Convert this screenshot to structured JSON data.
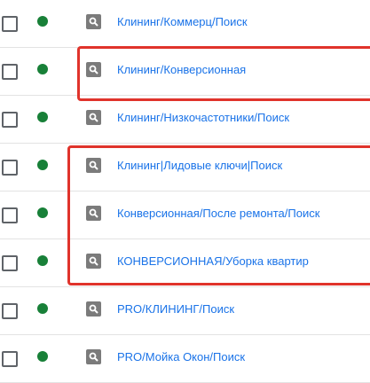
{
  "rows": [
    {
      "name": "Клининг/Коммерц/Поиск"
    },
    {
      "name": "Клининг/Конверсионная"
    },
    {
      "name": "Клининг/Низкочастотники/Поиск"
    },
    {
      "name": "Клининг|Лидовые ключи|Поиск"
    },
    {
      "name": "Конверсионная/После ремонта/Поиск"
    },
    {
      "name": "КОНВЕРСИОННАЯ/Уборка квартир"
    },
    {
      "name": "PRO/КЛИНИНГ/Поиск"
    },
    {
      "name": "PRO/Мойка Окон/Поиск"
    }
  ],
  "colors": {
    "status_dot": "#188038",
    "link": "#1a73e8",
    "highlight": "#e0332b",
    "type_badge": "#7b7b7b"
  },
  "icons": {
    "checkbox": "checkbox-icon",
    "status": "enabled-status-dot-icon",
    "campaign_type": "search-campaign-icon"
  }
}
